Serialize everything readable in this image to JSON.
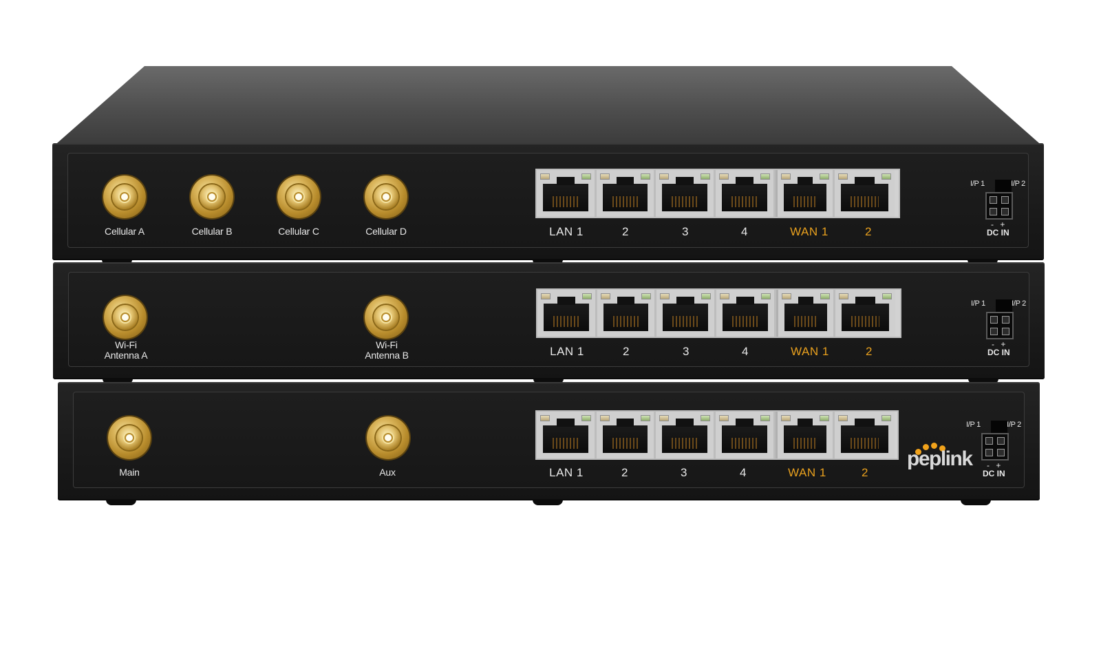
{
  "brand": {
    "logo_text": "peplink",
    "logo_dot_color": "#f2a31b"
  },
  "colors": {
    "chassis": "#1c1c1c",
    "wan_label": "#e8a01e",
    "connector_gold": "#d9b45a"
  },
  "units": [
    {
      "antennas": [
        {
          "label": "Cellular A"
        },
        {
          "label": "Cellular B"
        },
        {
          "label": "Cellular C"
        },
        {
          "label": "Cellular D"
        }
      ],
      "lan_labels": [
        "LAN 1",
        "2",
        "3",
        "4"
      ],
      "wan_labels": [
        "WAN 1",
        "2"
      ],
      "power": {
        "ip1": "I/P 1",
        "ip2": "I/P 2",
        "polarity": "- +",
        "label": "DC IN"
      }
    },
    {
      "antennas": [
        {
          "label": "Wi-Fi\nAntenna A"
        },
        {
          "label": "Wi-Fi\nAntenna B"
        }
      ],
      "lan_labels": [
        "LAN 1",
        "2",
        "3",
        "4"
      ],
      "wan_labels": [
        "WAN 1",
        "2"
      ],
      "power": {
        "ip1": "I/P 1",
        "ip2": "I/P 2",
        "polarity": "- +",
        "label": "DC IN"
      }
    },
    {
      "antennas": [
        {
          "label": "Main"
        },
        {
          "label": "Aux"
        }
      ],
      "lan_labels": [
        "LAN 1",
        "2",
        "3",
        "4"
      ],
      "wan_labels": [
        "WAN 1",
        "2"
      ],
      "power": {
        "ip1": "I/P 1",
        "ip2": "I/P 2",
        "polarity": "- +",
        "label": "DC IN"
      }
    }
  ]
}
